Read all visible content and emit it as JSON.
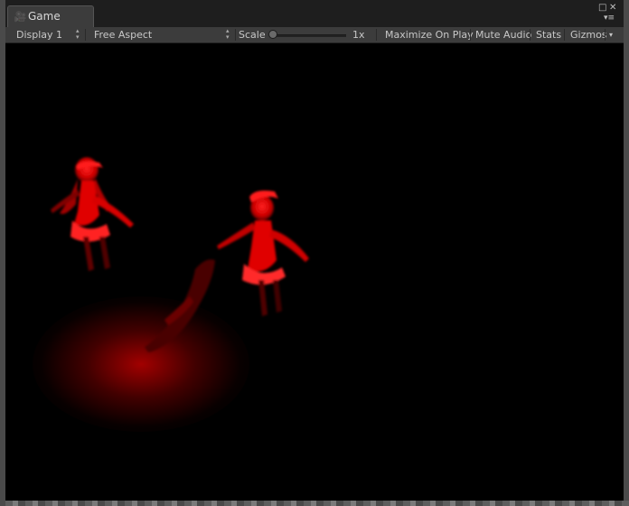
{
  "window": {
    "tab_title": "Game",
    "tab_icon": "unity-game-icon"
  },
  "toolbar": {
    "display": "Display 1",
    "aspect": "Free Aspect",
    "scale_label": "Scale",
    "scale_value": "1x",
    "scale_level": 0.0,
    "maximize": "Maximize On Play",
    "mute": "Mute Audio",
    "stats": "Stats",
    "gizmos": "Gizmos"
  },
  "viewport": {
    "background": "#000000",
    "accent": "#ff0000"
  }
}
